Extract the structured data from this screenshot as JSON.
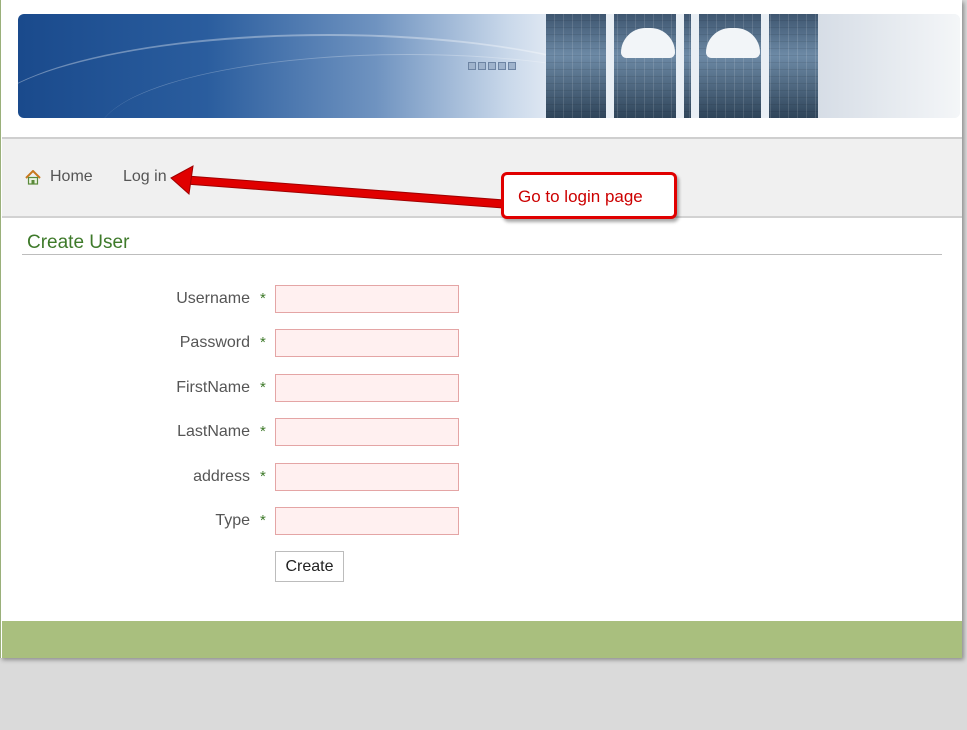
{
  "nav": {
    "home_label": "Home",
    "login_label": "Log in"
  },
  "annotation": {
    "text": "Go to login page"
  },
  "form": {
    "title": "Create User",
    "required_marker": "*",
    "fields": [
      {
        "label": "Username",
        "value": "",
        "placeholder": ""
      },
      {
        "label": "Password",
        "value": "",
        "placeholder": ""
      },
      {
        "label": "FirstName",
        "value": "",
        "placeholder": ""
      },
      {
        "label": "LastName",
        "value": "",
        "placeholder": ""
      },
      {
        "label": "address",
        "value": "",
        "placeholder": ""
      },
      {
        "label": "Type",
        "value": "",
        "placeholder": ""
      }
    ],
    "submit_label": "Create"
  },
  "colors": {
    "title_green": "#3e7a2a",
    "footer_green": "#a9bf7e",
    "annotation_red": "#e00000",
    "input_bg": "#fff0f0",
    "input_border": "#e4a5a5"
  },
  "icons": {
    "home": "home-icon",
    "arrow": "arrow-icon"
  }
}
